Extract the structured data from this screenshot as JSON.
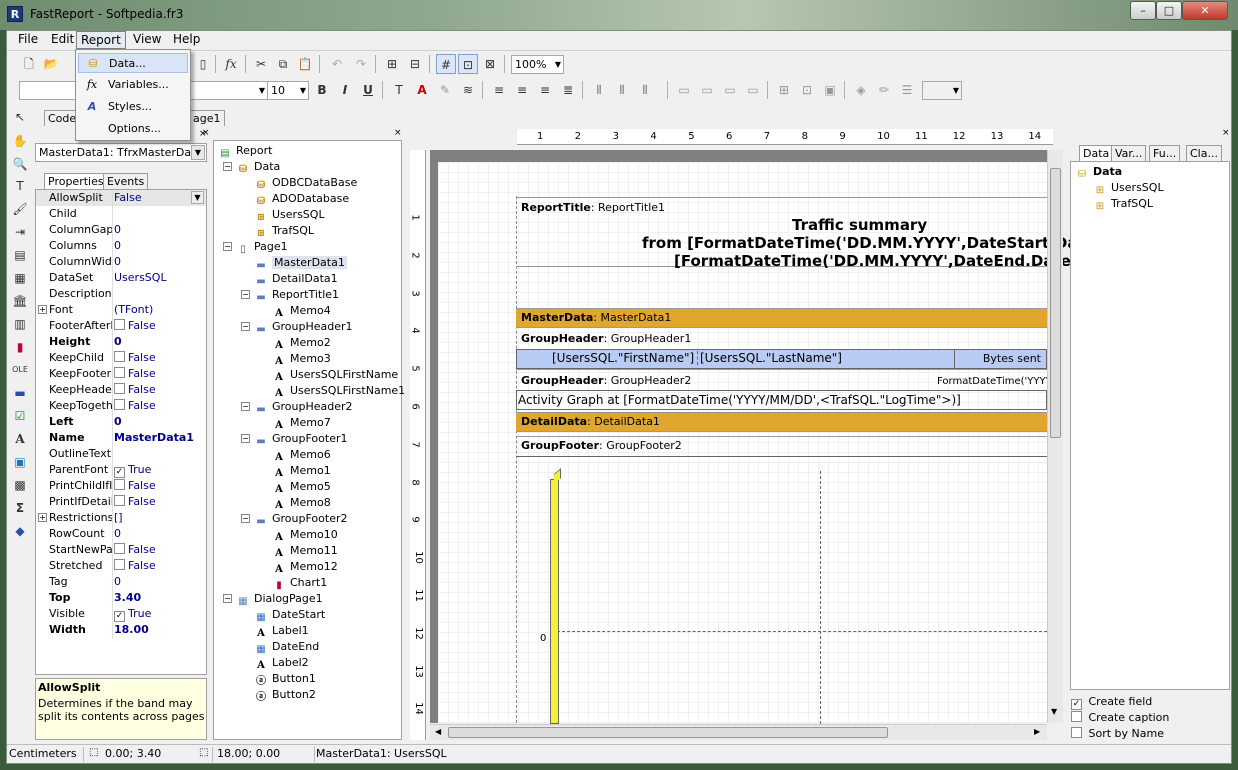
{
  "window": {
    "title": "FastReport - Softpedia.fr3",
    "icon": "app-icon-r",
    "btn_min": "–",
    "btn_max": "□",
    "btn_close": "✕"
  },
  "menu": {
    "items": [
      "File",
      "Edit",
      "Report",
      "View",
      "Help"
    ],
    "active": "Report"
  },
  "report_menu": [
    {
      "label": "Data...",
      "icon": "database-icon"
    },
    {
      "label": "Variables...",
      "icon": "function-icon"
    },
    {
      "label": "Styles...",
      "icon": "styles-icon"
    },
    {
      "label": "Options...",
      "icon": ""
    }
  ],
  "toolbar": {
    "zoom": "100%",
    "font_size": "10",
    "font_name": ""
  },
  "tabs": {
    "code": "Code",
    "page": "age1"
  },
  "inspector": {
    "object": "MasterData1: TfrxMasterData",
    "tabs": [
      "Properties",
      "Events"
    ],
    "props": [
      {
        "name": "AllowSplit",
        "value": "False",
        "type": "combo"
      },
      {
        "name": "Child",
        "value": ""
      },
      {
        "name": "ColumnGap",
        "value": "0"
      },
      {
        "name": "Columns",
        "value": "0"
      },
      {
        "name": "ColumnWidth",
        "value": "0"
      },
      {
        "name": "DataSet",
        "value": "UsersSQL"
      },
      {
        "name": "Description",
        "value": ""
      },
      {
        "name": "Font",
        "value": "(TFont)",
        "expand": true
      },
      {
        "name": "FooterAfterE",
        "value": "False",
        "check": false
      },
      {
        "name": "Height",
        "value": "0",
        "bold": true
      },
      {
        "name": "KeepChild",
        "value": "False",
        "check": false
      },
      {
        "name": "KeepFooter",
        "value": "False",
        "check": false
      },
      {
        "name": "KeepHeader",
        "value": "False",
        "check": false
      },
      {
        "name": "KeepTogethe",
        "value": "False",
        "check": false
      },
      {
        "name": "Left",
        "value": "0",
        "bold": true
      },
      {
        "name": "Name",
        "value": "MasterData1",
        "bold": true
      },
      {
        "name": "OutlineText",
        "value": ""
      },
      {
        "name": "ParentFont",
        "value": "True",
        "check": true
      },
      {
        "name": "PrintChildIfIn",
        "value": "False",
        "check": false
      },
      {
        "name": "PrintIfDetailE",
        "value": "False",
        "check": false
      },
      {
        "name": "Restrictions",
        "value": "[]",
        "expand": true
      },
      {
        "name": "RowCount",
        "value": "0"
      },
      {
        "name": "StartNewPag",
        "value": "False",
        "check": false
      },
      {
        "name": "Stretched",
        "value": "False",
        "check": false
      },
      {
        "name": "Tag",
        "value": "0"
      },
      {
        "name": "Top",
        "value": "3.40",
        "bold": true
      },
      {
        "name": "Visible",
        "value": "True",
        "check": true
      },
      {
        "name": "Width",
        "value": "18.00",
        "bold": true
      }
    ],
    "help_title": "AllowSplit",
    "help_text": "Determines if the band may split its contents across pages"
  },
  "tree": [
    {
      "label": "Report",
      "level": 0,
      "icon": "report-icon",
      "exp": "none"
    },
    {
      "label": "Data",
      "level": 1,
      "icon": "db-icon",
      "exp": "minus"
    },
    {
      "label": "ODBCDataBase",
      "level": 2,
      "icon": "db-icon"
    },
    {
      "label": "ADODatabase",
      "level": 2,
      "icon": "db-icon"
    },
    {
      "label": "UsersSQL",
      "level": 2,
      "icon": "query-icon"
    },
    {
      "label": "TrafSQL",
      "level": 2,
      "icon": "query-icon"
    },
    {
      "label": "Page1",
      "level": 1,
      "icon": "page-icon",
      "exp": "minus"
    },
    {
      "label": "MasterData1",
      "level": 2,
      "icon": "band-icon",
      "selected": true
    },
    {
      "label": "DetailData1",
      "level": 2,
      "icon": "band-icon"
    },
    {
      "label": "ReportTitle1",
      "level": 2,
      "icon": "band-icon",
      "exp": "minus"
    },
    {
      "label": "Memo4",
      "level": 3,
      "icon": "text-icon"
    },
    {
      "label": "GroupHeader1",
      "level": 2,
      "icon": "band-icon",
      "exp": "minus"
    },
    {
      "label": "Memo2",
      "level": 3,
      "icon": "text-icon"
    },
    {
      "label": "Memo3",
      "level": 3,
      "icon": "text-icon"
    },
    {
      "label": "UsersSQLFirstName",
      "level": 3,
      "icon": "text-icon"
    },
    {
      "label": "UsersSQLFirstName1",
      "level": 3,
      "icon": "text-icon"
    },
    {
      "label": "GroupHeader2",
      "level": 2,
      "icon": "band-icon",
      "exp": "minus"
    },
    {
      "label": "Memo7",
      "level": 3,
      "icon": "text-icon"
    },
    {
      "label": "GroupFooter1",
      "level": 2,
      "icon": "band-icon",
      "exp": "minus"
    },
    {
      "label": "Memo6",
      "level": 3,
      "icon": "text-icon"
    },
    {
      "label": "Memo1",
      "level": 3,
      "icon": "text-icon"
    },
    {
      "label": "Memo5",
      "level": 3,
      "icon": "text-icon"
    },
    {
      "label": "Memo8",
      "level": 3,
      "icon": "text-icon"
    },
    {
      "label": "GroupFooter2",
      "level": 2,
      "icon": "band-icon",
      "exp": "minus"
    },
    {
      "label": "Memo10",
      "level": 3,
      "icon": "text-icon"
    },
    {
      "label": "Memo11",
      "level": 3,
      "icon": "text-icon"
    },
    {
      "label": "Memo12",
      "level": 3,
      "icon": "text-icon"
    },
    {
      "label": "Chart1",
      "level": 3,
      "icon": "chart-icon"
    },
    {
      "label": "DialogPage1",
      "level": 1,
      "icon": "dialog-icon",
      "exp": "minus"
    },
    {
      "label": "DateStart",
      "level": 2,
      "icon": "date-icon"
    },
    {
      "label": "Label1",
      "level": 2,
      "icon": "label-icon"
    },
    {
      "label": "DateEnd",
      "level": 2,
      "icon": "date-icon"
    },
    {
      "label": "Label2",
      "level": 2,
      "icon": "label-icon"
    },
    {
      "label": "Button1",
      "level": 2,
      "icon": "button-icon"
    },
    {
      "label": "Button2",
      "level": 2,
      "icon": "button-icon"
    }
  ],
  "ruler_h": [
    "1",
    "2",
    "3",
    "4",
    "5",
    "6",
    "7",
    "8",
    "9",
    "10",
    "11",
    "12",
    "13",
    "14"
  ],
  "ruler_v": [
    "1",
    "2",
    "3",
    "4",
    "5",
    "6",
    "7",
    "8",
    "9",
    "10",
    "11",
    "12",
    "13",
    "14"
  ],
  "designer": {
    "report_title": {
      "band": "ReportTitle",
      "name": ": ReportTitle1",
      "line1": "Traffic summary",
      "line2": "from [FormatDateTime('DD.MM.YYYY',DateStart.Date)",
      "line3": "[FormatDateTime('DD.MM.YYYY',DateEnd.Date)]"
    },
    "master": {
      "band": "MasterData",
      "name": ": MasterData1"
    },
    "gh1": {
      "band": "GroupHeader",
      "name": ": GroupHeader1",
      "field1": "[UsersSQL.\"FirstName\"]",
      "field2": "[UsersSQL.\"LastName\"]",
      "field3": "Bytes sent"
    },
    "gh2": {
      "band": "GroupHeader",
      "name": ": GroupHeader2",
      "right": "FormatDateTime('YYYY",
      "activity": "Activity Graph at [FormatDateTime('YYYY/MM/DD',<TrafSQL.\"LogTime\">)]"
    },
    "detail": {
      "band": "DetailData",
      "name": ": DetailData1"
    },
    "gf": {
      "band": "GroupFooter",
      "name": ": GroupFooter2",
      "axis_zero": "0"
    }
  },
  "datatree": {
    "tabs": [
      "Data",
      "Var...",
      "Fu...",
      "Cla..."
    ],
    "root": "Data",
    "items": [
      "UsersSQL",
      "TrafSQL"
    ],
    "options": [
      {
        "label": "Create field",
        "checked": true
      },
      {
        "label": "Create caption",
        "checked": false
      },
      {
        "label": "Sort by Name",
        "checked": false
      }
    ]
  },
  "status": {
    "units": "Centimeters",
    "pos": "0.00; 3.40",
    "size": "18.00; 0.00",
    "object": "MasterData1: UsersSQL"
  },
  "colors": {
    "band": "#e0a62e",
    "field": "#b7cbf5",
    "chart_bar": "#f5f03c"
  }
}
